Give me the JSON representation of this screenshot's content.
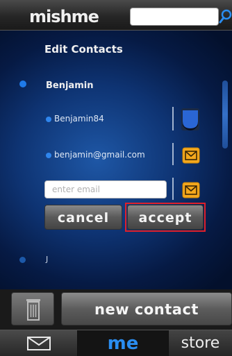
{
  "header": {
    "logo_text": "mishme",
    "search": {
      "value": "",
      "placeholder": ""
    }
  },
  "edit_contacts": {
    "title": "Edit Contacts",
    "contact": {
      "name": "Benjamin",
      "details": [
        {
          "value": "Benjamin84",
          "icon": "chat-icon"
        },
        {
          "value": "benjamin@gmail.com",
          "icon": "mail-icon"
        }
      ],
      "new_email": {
        "value": "",
        "placeholder": "enter email",
        "icon": "mail-icon"
      }
    },
    "cancel_label": "cancel",
    "accept_label": "accept",
    "next_contact_name": "J"
  },
  "actions": {
    "delete_icon": "trash-icon",
    "new_contact_label": "new contact"
  },
  "nav": {
    "mail_icon": "mail-icon",
    "me_label": "me",
    "store_label": "store"
  },
  "colors": {
    "accent": "#2a8df0",
    "mail_icon": "#f4a81d",
    "highlight": "#e0202a"
  }
}
